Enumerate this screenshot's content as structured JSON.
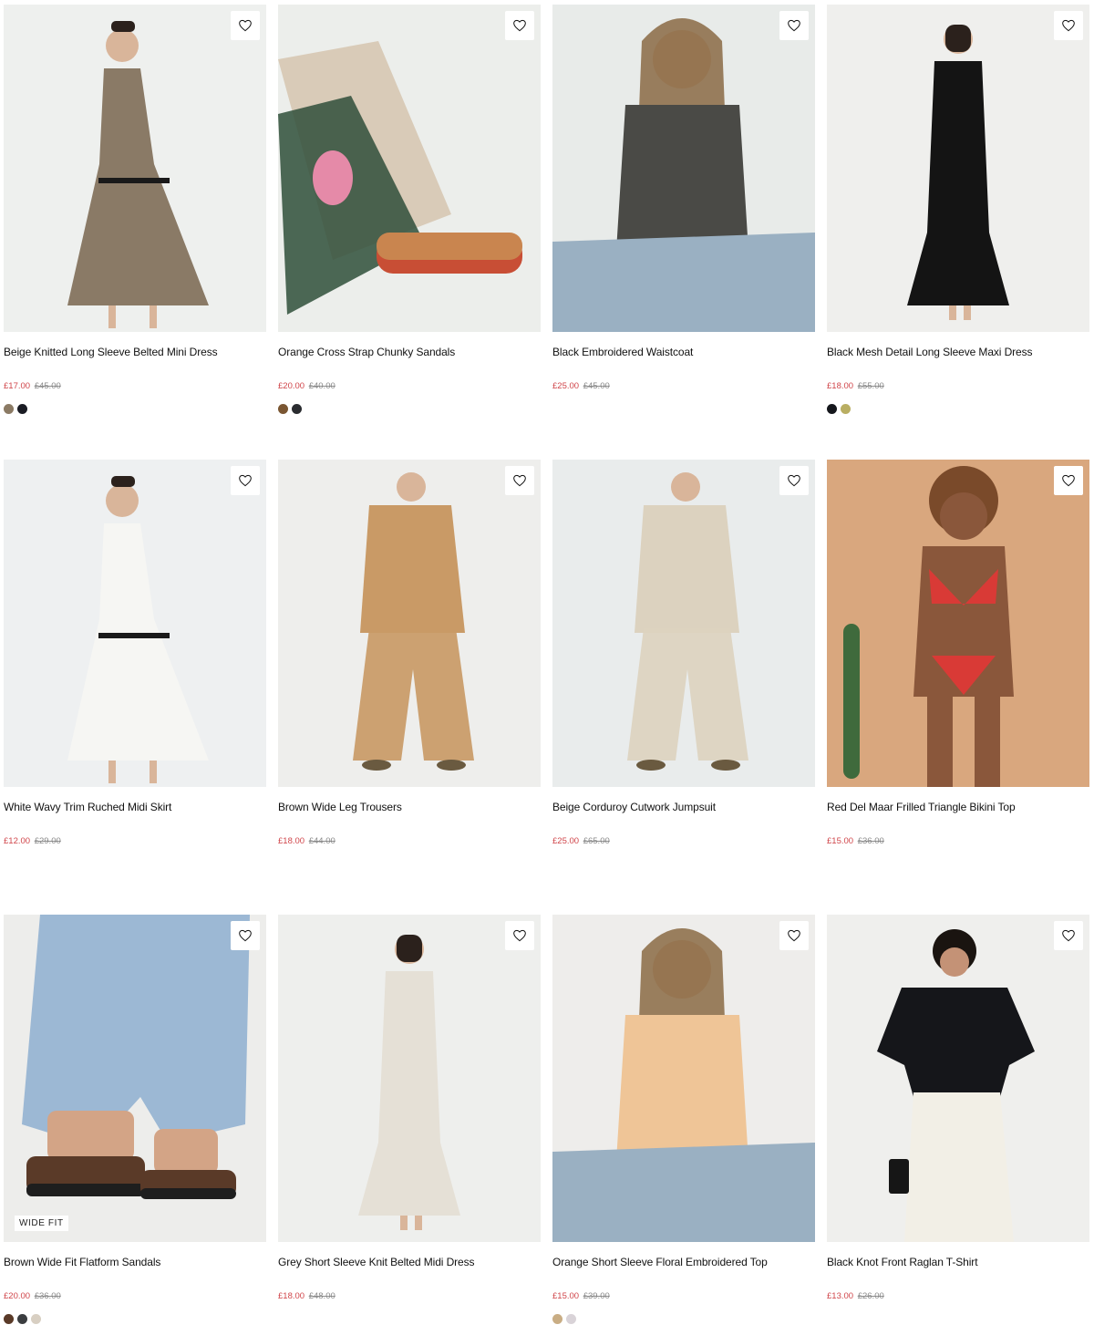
{
  "products": [
    {
      "title": "Beige Knitted Long Sleeve Belted Mini Dress",
      "price_now": "£17.00",
      "price_was": "£45.00",
      "swatches": [
        "#8b7a64",
        "#1a1c24"
      ],
      "bg": "#eef0ee",
      "fg": "#8a7a66",
      "photo": "dress"
    },
    {
      "title": "Orange Cross Strap Chunky Sandals",
      "price_now": "£20.00",
      "price_was": "£40.00",
      "swatches": [
        "#7a5632",
        "#2a2c30"
      ],
      "bg": "#eceeeb",
      "fg": "#c9854f",
      "photo": "sandal"
    },
    {
      "title": "Black Embroidered Waistcoat",
      "price_now": "£25.00",
      "price_was": "£45.00",
      "swatches": [],
      "bg": "#e8ebe9",
      "fg": "#4a4a46",
      "photo": "seated"
    },
    {
      "title": "Black Mesh Detail Long Sleeve Maxi Dress",
      "price_now": "£18.00",
      "price_was": "£55.00",
      "swatches": [
        "#15171c",
        "#b9ae62"
      ],
      "bg": "#efefed",
      "fg": "#141414",
      "photo": "maxi"
    },
    {
      "title": "White Wavy Trim Ruched Midi Skirt",
      "price_now": "£12.00",
      "price_was": "£29.00",
      "swatches": [],
      "bg": "#eef0f1",
      "fg": "#f6f6f3",
      "photo": "dress"
    },
    {
      "title": "Brown Wide Leg Trousers",
      "price_now": "£18.00",
      "price_was": "£44.00",
      "swatches": [],
      "bg": "#eeeeec",
      "fg": "#c99a66",
      "photo": "suit"
    },
    {
      "title": "Beige Corduroy Cutwork Jumpsuit",
      "price_now": "£25.00",
      "price_was": "£65.00",
      "swatches": [],
      "bg": "#e9ecec",
      "fg": "#dcd2bf",
      "photo": "suit"
    },
    {
      "title": "Red Del Maar Frilled Triangle Bikini Top",
      "price_now": "£15.00",
      "price_was": "£36.00",
      "swatches": [],
      "bg": "#d9a77e",
      "fg": "#8b5238",
      "photo": "bikini"
    },
    {
      "title": "Brown Wide Fit Flatform Sandals",
      "price_now": "£20.00",
      "price_was": "£36.00",
      "swatches": [
        "#5a3a28",
        "#3b3d40",
        "#d8cfc2"
      ],
      "bg": "#ededeb",
      "fg": "#9cb8d4",
      "photo": "legs",
      "tag": "WIDE FIT"
    },
    {
      "title": "Grey Short Sleeve Knit Belted Midi Dress",
      "price_now": "£18.00",
      "price_was": "£48.00",
      "swatches": [],
      "bg": "#eeefed",
      "fg": "#e5e0d6",
      "photo": "maxi"
    },
    {
      "title": "Orange Short Sleeve Floral Embroidered Top",
      "price_now": "£15.00",
      "price_was": "£39.00",
      "swatches": [
        "#c9ad84",
        "#d9d3d8"
      ],
      "bg": "#eeedeb",
      "fg": "#efc597",
      "photo": "seated"
    },
    {
      "title": "Black Knot Front Raglan T-Shirt",
      "price_now": "£13.00",
      "price_was": "£26.00",
      "swatches": [],
      "bg": "#efefed",
      "fg": "#15161a",
      "photo": "tee"
    }
  ]
}
